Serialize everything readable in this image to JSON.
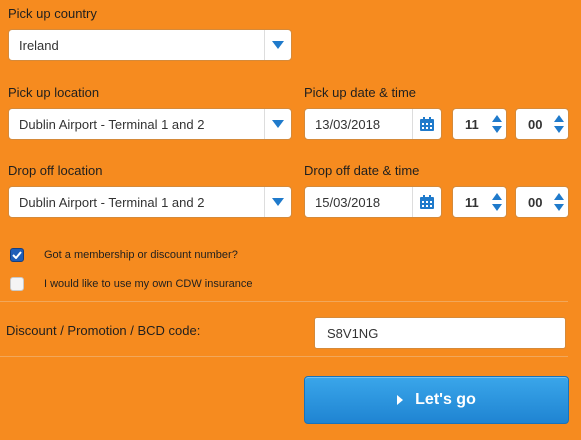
{
  "pickup_country": {
    "label": "Pick up country",
    "value": "Ireland"
  },
  "pickup_location": {
    "label": "Pick up location",
    "value": "Dublin Airport - Terminal 1 and 2"
  },
  "pickup_datetime": {
    "label": "Pick up date & time",
    "date": "13/03/2018",
    "hour": "11",
    "minute": "00"
  },
  "dropoff_location": {
    "label": "Drop off location",
    "value": "Dublin Airport - Terminal 1 and 2"
  },
  "dropoff_datetime": {
    "label": "Drop off date & time",
    "date": "15/03/2018",
    "hour": "11",
    "minute": "00"
  },
  "options": {
    "membership": {
      "label": "Got a membership or discount number?",
      "checked": true
    },
    "cdw": {
      "label": "I would like to use my own CDW insurance",
      "checked": false
    }
  },
  "discount": {
    "label": "Discount / Promotion / BCD code:",
    "value": "S8V1NG"
  },
  "submit": {
    "label": "Let's go"
  },
  "colors": {
    "background": "#f68b1f",
    "accent": "#1f84d2"
  },
  "icons": {
    "dropdown": "caret-down-icon",
    "calendar": "calendar-icon",
    "spinner": "spinner-arrows-icon",
    "check": "check-icon"
  }
}
